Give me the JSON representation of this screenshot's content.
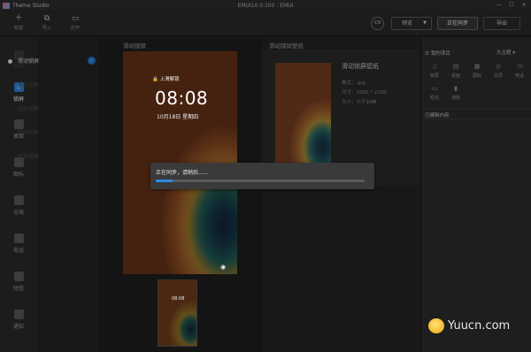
{
  "app": {
    "title": "Theme Studio",
    "window_title": "EMUI10.0.100 : EMUI"
  },
  "window_controls": [
    "—",
    "☐",
    "✕"
  ],
  "toolbar": {
    "buttons": [
      {
        "label": "新建",
        "icon": "plus-icon"
      },
      {
        "label": "导入",
        "icon": "import-icon"
      },
      {
        "label": "打开",
        "icon": "folder-icon"
      }
    ],
    "language_toggle": "CN",
    "preview_label": "预览",
    "sync_label": "正在同步",
    "export_label": "导出"
  },
  "leftnav": {
    "items": [
      {
        "label": "icon",
        "state": "dim"
      },
      {
        "label": "锁屏",
        "state": "active"
      },
      {
        "label": "桌面",
        "state": "normal"
      },
      {
        "label": "图标",
        "state": "normal"
      },
      {
        "label": "全局",
        "state": "normal"
      },
      {
        "label": "电话",
        "state": "normal"
      },
      {
        "label": "短信",
        "state": "normal"
      },
      {
        "label": "通知",
        "state": "normal"
      }
    ]
  },
  "subnav": {
    "items": [
      {
        "label": "滑动锁屏",
        "active": true
      },
      {
        "label": "杂志锁屏",
        "active": false
      },
      {
        "label": "动态锁屏",
        "active": false
      },
      {
        "label": "视频锁屏",
        "active": false
      },
      {
        "label": "全景锁屏",
        "active": false
      }
    ]
  },
  "canvas": {
    "title": "滑动锁屏",
    "lock_status": "🔒 上滑解锁",
    "time": "08:08",
    "date": "10月18日 星期四",
    "thumb_time": "08:08"
  },
  "wallpaper": {
    "header": "滑动锁屏壁纸",
    "name": "滑动锁屏壁纸",
    "format": "格式：.jpg",
    "size": "尺寸：1080 * 2160",
    "filesize": "大小：小于1MB"
  },
  "right_panel": {
    "title": "我的项目",
    "dropdown": "大主题",
    "items": [
      {
        "label": "锁屏",
        "icon": "lock-icon",
        "glyph": "▯"
      },
      {
        "label": "桌面",
        "icon": "desktop-icon",
        "glyph": "▤"
      },
      {
        "label": "图标",
        "icon": "apps-icon",
        "glyph": "▦"
      },
      {
        "label": "全局",
        "icon": "global-icon",
        "glyph": "◎"
      },
      {
        "label": "电话",
        "icon": "phone-icon",
        "glyph": "☏"
      },
      {
        "label": "短信",
        "icon": "message-icon",
        "glyph": "▭"
      },
      {
        "label": "通知",
        "icon": "notification-icon",
        "glyph": "▮"
      }
    ],
    "edited_title": "已编辑内容"
  },
  "dialog": {
    "message": "正在同步，请稍后......",
    "progress": 0.08
  },
  "watermark": {
    "text": "Yuucn.com"
  }
}
